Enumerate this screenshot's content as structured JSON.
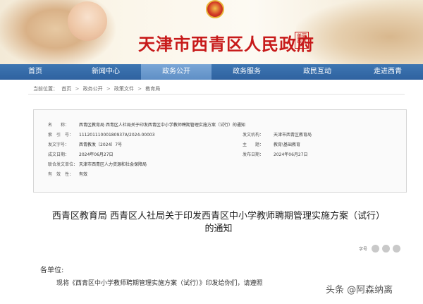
{
  "header": {
    "site_title": "天津市西青区人民政府",
    "seal_text": "美丽西青"
  },
  "nav": {
    "items": [
      "首页",
      "新闻中心",
      "政务公开",
      "政务服务",
      "政民互动",
      "走进西青"
    ],
    "active_index": 2
  },
  "breadcrumb": {
    "prefix": "当前位置：",
    "items": [
      "首页",
      "政务公开",
      "政策文件",
      "教育局"
    ],
    "separator": ">"
  },
  "meta": {
    "name_label": "名　　称：",
    "name_value": "西青区教育局 西青区人社局关于印发西青区中小学教师聘期管理实施方案（试行）的通知",
    "index_label": "索　引　号：",
    "index_value": "11120111000180937A/2024-00003",
    "publisher_label": "发文机构：",
    "publisher_value": "天津市西青区教育局",
    "doc_no_label": "发文字号：",
    "doc_no_value": "西青教发〔2024〕7号",
    "topic_label": "主　　题：",
    "topic_value": "教育\\基础教育",
    "date_label": "成文日期：",
    "date_value": "2024年06月27日",
    "pub_date_label": "发布日期：",
    "pub_date_value": "2024年06月27日",
    "joint_label": "联合发文单位：",
    "joint_value": "天津市西青区人力资源和社会保障局",
    "validity_label": "有　效　性：",
    "validity_value": "有效"
  },
  "article": {
    "title_line1": "西青区教育局 西青区人社局关于印发西青区中小学教师聘期管理实施方案（试行）",
    "title_line2": "的通知",
    "font_label": "字号",
    "salutation": "各单位:",
    "body_line1": "现将《西青区中小学教师聘期管理实施方案（试行）》印发给你们，请遵照"
  },
  "watermark": "头条 @阿森纳离"
}
